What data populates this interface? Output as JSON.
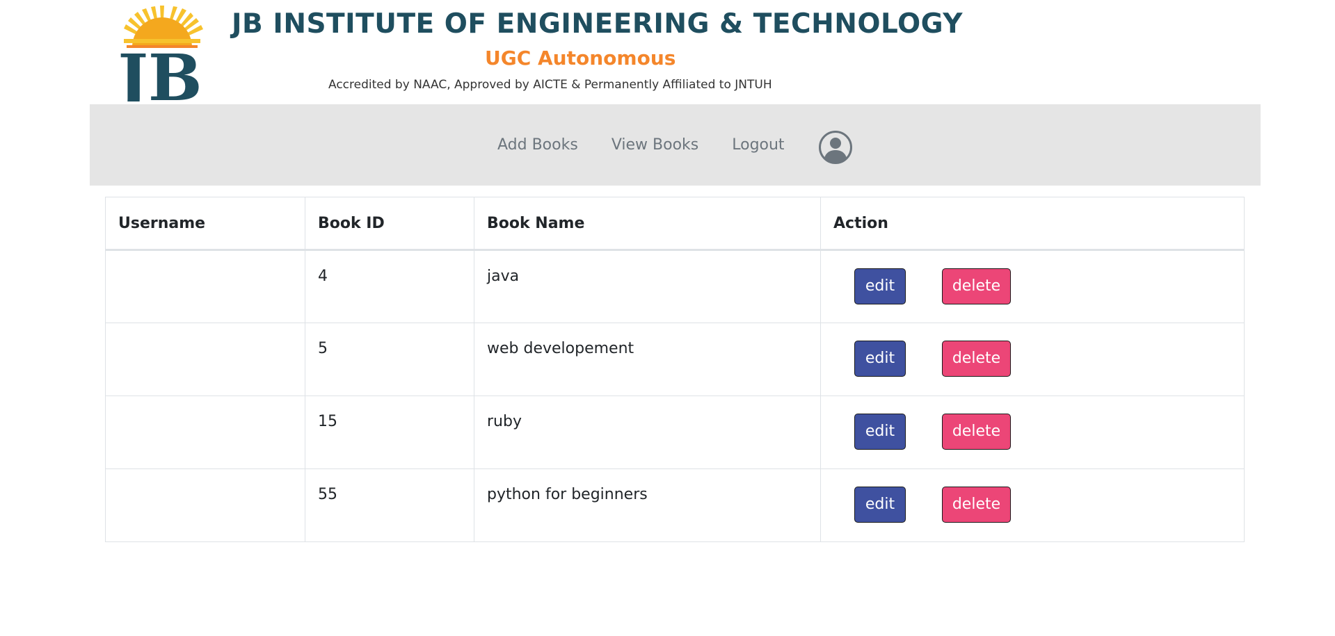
{
  "header": {
    "institution_name": "JB INSTITUTE OF ENGINEERING & TECHNOLOGY",
    "institution_status": "UGC Autonomous",
    "accreditation": "Accredited by NAAC, Approved by AICTE & Permanently Affiliated to JNTUH",
    "logo_text": "JB",
    "logo_icon": "sunrise-logo-icon",
    "colors": {
      "name": "#1f4e5f",
      "status": "#f4862b",
      "sun": "#f7c22d"
    }
  },
  "nav": {
    "items": [
      {
        "label": "Add Books"
      },
      {
        "label": "View Books"
      },
      {
        "label": "Logout"
      }
    ],
    "profile_icon": "user-circle-icon",
    "background": "#e5e5e5"
  },
  "table": {
    "headers": [
      "Username",
      "Book ID",
      "Book Name",
      "Action"
    ],
    "rows": [
      {
        "username": "",
        "book_id": "4",
        "book_name": "java",
        "edit_label": "edit",
        "delete_label": "delete"
      },
      {
        "username": "",
        "book_id": "5",
        "book_name": "web developement",
        "edit_label": "edit",
        "delete_label": "delete"
      },
      {
        "username": "",
        "book_id": "15",
        "book_name": "ruby",
        "edit_label": "edit",
        "delete_label": "delete"
      },
      {
        "username": "",
        "book_id": "55",
        "book_name": "python for beginners",
        "edit_label": "edit",
        "delete_label": "delete"
      }
    ],
    "colors": {
      "edit": "#3f51a0",
      "delete": "#ec4677"
    }
  }
}
